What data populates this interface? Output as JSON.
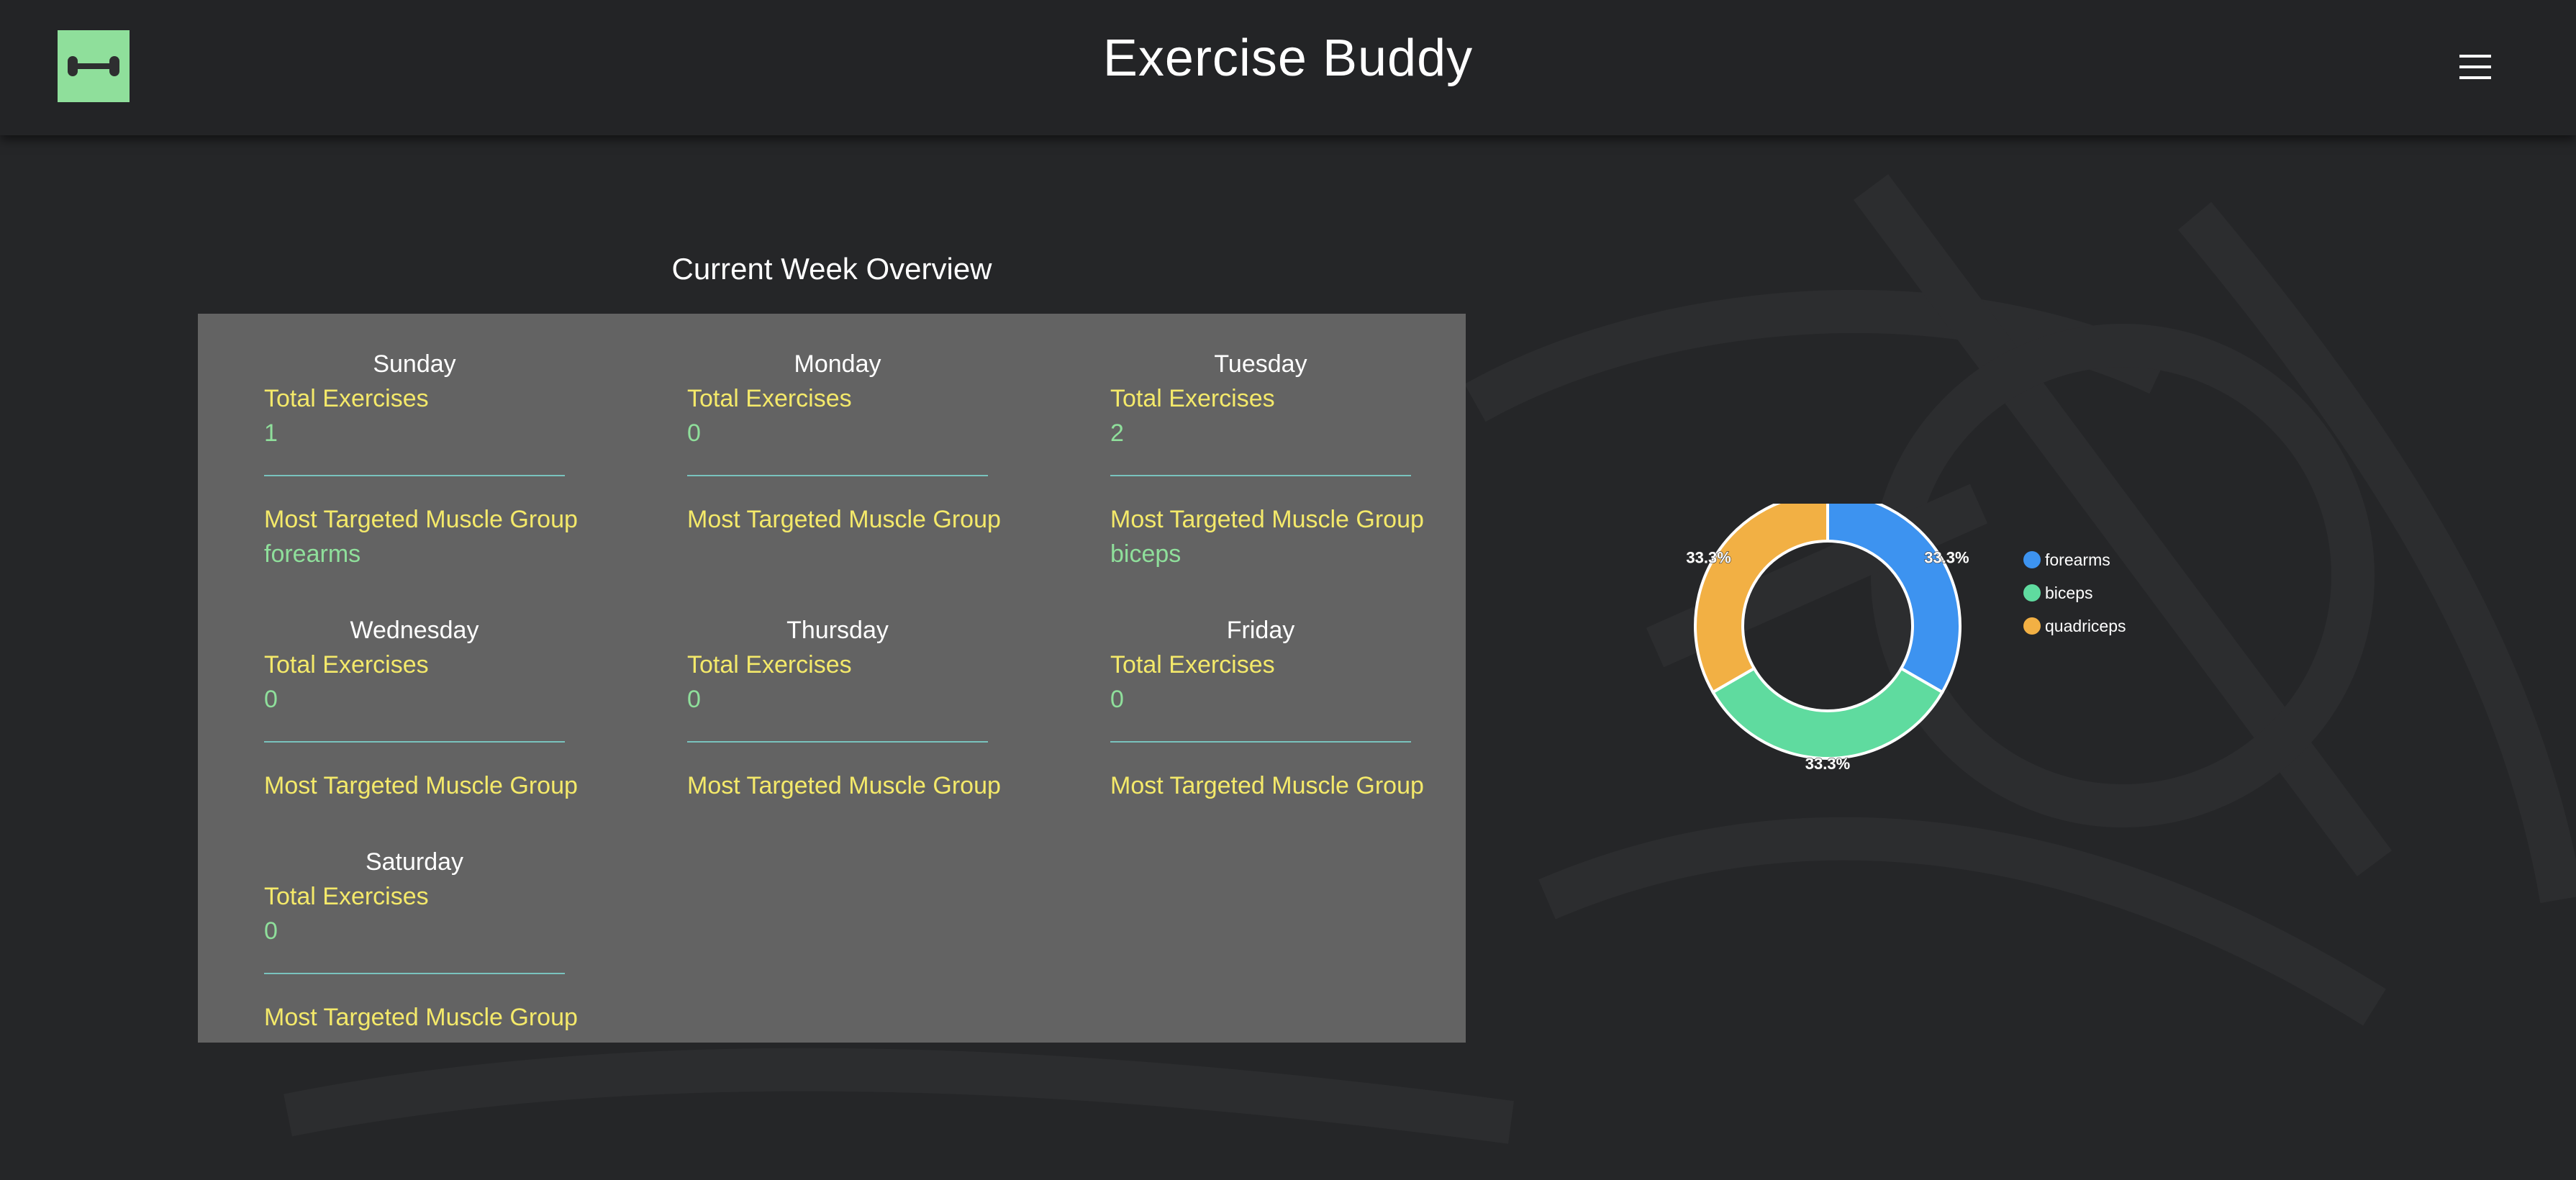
{
  "header": {
    "title": "Exercise Buddy",
    "logo_icon": "dumbbell-icon",
    "menu_icon": "hamburger-menu-icon"
  },
  "overview": {
    "title": "Current Week Overview",
    "total_label": "Total Exercises",
    "muscle_label": "Most Targeted Muscle Group",
    "days": [
      {
        "name": "Sunday",
        "total": "1",
        "muscle": "forearms"
      },
      {
        "name": "Monday",
        "total": "0",
        "muscle": ""
      },
      {
        "name": "Tuesday",
        "total": "2",
        "muscle": "biceps"
      },
      {
        "name": "Wednesday",
        "total": "0",
        "muscle": ""
      },
      {
        "name": "Thursday",
        "total": "0",
        "muscle": ""
      },
      {
        "name": "Friday",
        "total": "0",
        "muscle": ""
      },
      {
        "name": "Saturday",
        "total": "0",
        "muscle": ""
      }
    ]
  },
  "chart_data": {
    "type": "pie",
    "categories": [
      "forearms",
      "biceps",
      "quadriceps"
    ],
    "values": [
      33.3,
      33.3,
      33.3
    ],
    "data_labels": [
      "33.3%",
      "33.3%",
      "33.3%"
    ],
    "colors": [
      "#3d93f0",
      "#5fdb9f",
      "#f2b044"
    ],
    "legend": "right"
  },
  "colors": {
    "background": "#252628",
    "header": "#232426",
    "card": "#636363",
    "accent_green": "#8fdf9b",
    "label_yellow": "#f4e96a",
    "divider": "#79c3be"
  }
}
